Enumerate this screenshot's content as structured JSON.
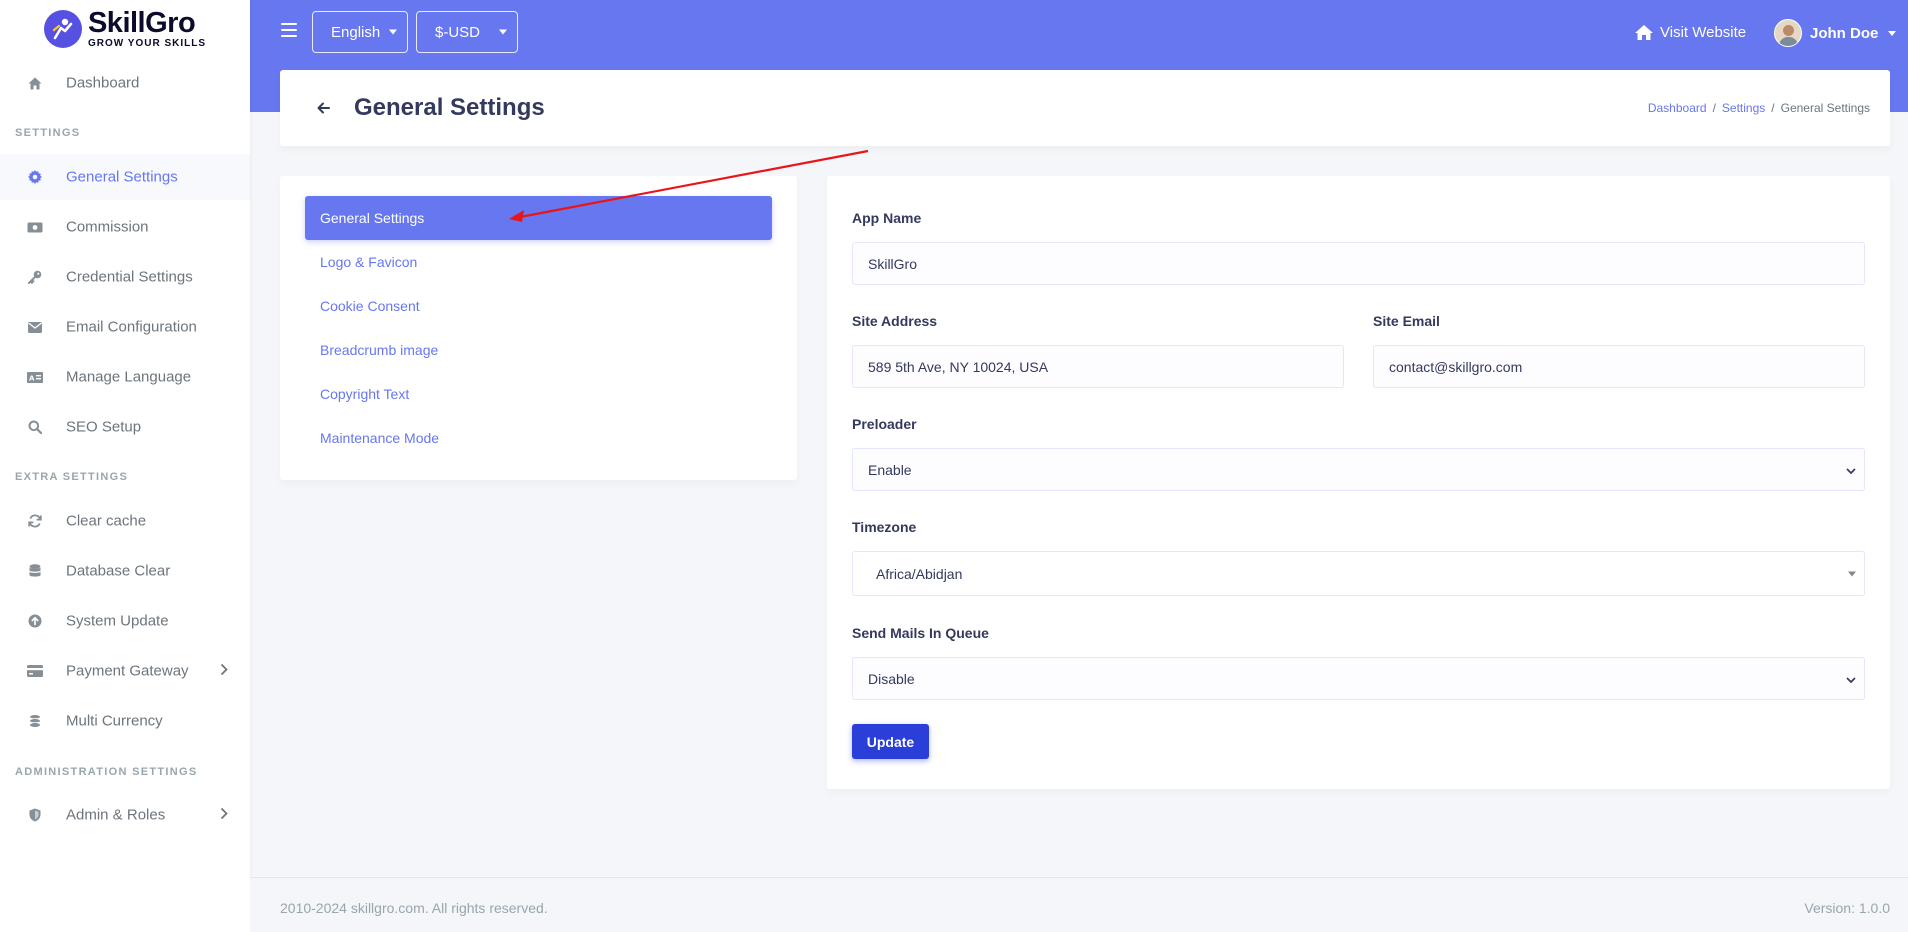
{
  "brand": {
    "name": "SkillGro",
    "tagline": "GROW YOUR SKILLS"
  },
  "sidebar": {
    "items": [
      {
        "label": "Dashboard",
        "icon": "home-icon"
      },
      {
        "section": "SETTINGS"
      },
      {
        "label": "General Settings",
        "icon": "gear-icon",
        "active": true
      },
      {
        "label": "Commission",
        "icon": "money-icon"
      },
      {
        "label": "Credential Settings",
        "icon": "key-icon"
      },
      {
        "label": "Email Configuration",
        "icon": "envelope-icon"
      },
      {
        "label": "Manage Language",
        "icon": "language-icon"
      },
      {
        "label": "SEO Setup",
        "icon": "search-icon"
      },
      {
        "section": "EXTRA SETTINGS"
      },
      {
        "label": "Clear cache",
        "icon": "refresh-icon"
      },
      {
        "label": "Database Clear",
        "icon": "database-icon"
      },
      {
        "label": "System Update",
        "icon": "upload-circle-icon"
      },
      {
        "label": "Payment Gateway",
        "icon": "credit-card-icon",
        "has_submenu": true
      },
      {
        "label": "Multi Currency",
        "icon": "coins-icon"
      },
      {
        "section": "ADMINISTRATION SETTINGS"
      },
      {
        "label": "Admin & Roles",
        "icon": "shield-icon",
        "has_submenu": true
      }
    ]
  },
  "topbar": {
    "language": "English",
    "currency": "$-USD",
    "visit_website": "Visit Website",
    "user_name": "John Doe"
  },
  "header": {
    "title": "General Settings",
    "breadcrumbs": [
      "Dashboard",
      "Settings",
      "General Settings"
    ]
  },
  "settings_nav": {
    "items": [
      {
        "label": "General Settings",
        "active": true
      },
      {
        "label": "Logo & Favicon"
      },
      {
        "label": "Cookie Consent"
      },
      {
        "label": "Breadcrumb image"
      },
      {
        "label": "Copyright Text"
      },
      {
        "label": "Maintenance Mode"
      }
    ]
  },
  "form": {
    "app_name": {
      "label": "App Name",
      "value": "SkillGro"
    },
    "site_address": {
      "label": "Site Address",
      "value": "589 5th Ave, NY 10024, USA"
    },
    "site_email": {
      "label": "Site Email",
      "value": "contact@skillgro.com"
    },
    "preloader": {
      "label": "Preloader",
      "value": "Enable"
    },
    "timezone": {
      "label": "Timezone",
      "value": "Africa/Abidjan"
    },
    "send_mails": {
      "label": "Send Mails In Queue",
      "value": "Disable"
    },
    "submit_label": "Update"
  },
  "footer": {
    "copyright": "2010-2024 skillgro.com. All rights reserved.",
    "version": "Version: 1.0.0"
  },
  "colors": {
    "primary": "#6777ef",
    "button": "#2a3ed8",
    "annotation_arrow": "#e8151b"
  }
}
